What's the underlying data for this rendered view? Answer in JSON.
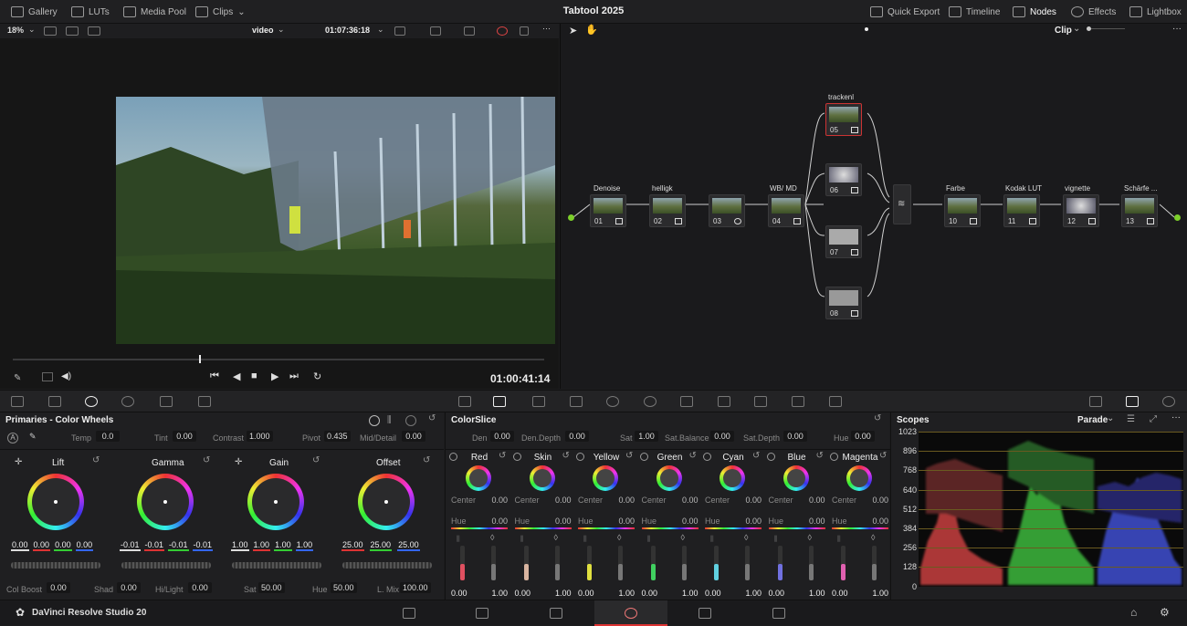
{
  "topbar": {
    "gallery": "Gallery",
    "luts": "LUTs",
    "media_pool": "Media Pool",
    "clips": "Clips",
    "title": "Tabtool 2025",
    "quick_export": "Quick Export",
    "timeline": "Timeline",
    "nodes": "Nodes",
    "effects": "Effects",
    "lightbox": "Lightbox"
  },
  "viewer": {
    "zoom": "18%",
    "view_mode": "video",
    "timecode": "01:07:36:18",
    "playhead_timecode": "01:00:41:14",
    "scrub_position": 0.35
  },
  "nodes": {
    "mode": "Clip",
    "list": [
      {
        "label": "Denoise",
        "num": "01"
      },
      {
        "label": "helligk",
        "num": "02"
      },
      {
        "label": "",
        "num": "03"
      },
      {
        "label": "WB/ MD",
        "num": "04"
      },
      {
        "label": "trackenl",
        "num": "05"
      },
      {
        "label": "",
        "num": "06"
      },
      {
        "label": "",
        "num": "07"
      },
      {
        "label": "",
        "num": "08"
      },
      {
        "label": "Farbe",
        "num": "10"
      },
      {
        "label": "Kodak LUT",
        "num": "11"
      },
      {
        "label": "vignette",
        "num": "12"
      },
      {
        "label": "Schärfe ...",
        "num": "13"
      }
    ]
  },
  "primaries": {
    "title": "Primaries - Color Wheels",
    "temp_label": "Temp",
    "temp": "0.0",
    "tint_label": "Tint",
    "tint": "0.00",
    "contrast_label": "Contrast",
    "contrast": "1.000",
    "pivot_label": "Pivot",
    "pivot": "0.435",
    "middetail_label": "Mid/Detail",
    "middetail": "0.00",
    "wheels": [
      {
        "name": "Lift",
        "values": [
          "0.00",
          "0.00",
          "0.00",
          "0.00"
        ]
      },
      {
        "name": "Gamma",
        "values": [
          "-0.01",
          "-0.01",
          "-0.01",
          "-0.01"
        ]
      },
      {
        "name": "Gain",
        "values": [
          "1.00",
          "1.00",
          "1.00",
          "1.00"
        ]
      },
      {
        "name": "Offset",
        "values": [
          "25.00",
          "25.00",
          "25.00"
        ]
      }
    ],
    "colboost_label": "Col Boost",
    "colboost": "0.00",
    "shad_label": "Shad",
    "shad": "0.00",
    "hilight_label": "Hi/Light",
    "hilight": "0.00",
    "sat_label": "Sat",
    "sat": "50.00",
    "hue_label": "Hue",
    "hue": "50.00",
    "lmix_label": "L. Mix",
    "lmix": "100.00"
  },
  "colorslice": {
    "title": "ColorSlice",
    "den_label": "Den",
    "den": "0.00",
    "dendepth_label": "Den.Depth",
    "dendepth": "0.00",
    "sat_label": "Sat",
    "sat": "1.00",
    "satbal_label": "Sat.Balance",
    "satbal": "0.00",
    "satdepth_label": "Sat.Depth",
    "satdepth": "0.00",
    "hue_label": "Hue",
    "hue": "0.00",
    "center_label": "Center",
    "hue_row_label": "Hue",
    "slices": [
      {
        "name": "Red",
        "center": "0.00",
        "hue": "0.00",
        "v1": "0.00",
        "v2": "1.00",
        "color": "#e05060"
      },
      {
        "name": "Skin",
        "center": "0.00",
        "hue": "0.00",
        "v1": "0.00",
        "v2": "1.00",
        "color": "#d8b4a0"
      },
      {
        "name": "Yellow",
        "center": "0.00",
        "hue": "0.00",
        "v1": "0.00",
        "v2": "1.00",
        "color": "#e0e040"
      },
      {
        "name": "Green",
        "center": "0.00",
        "hue": "0.00",
        "v1": "0.00",
        "v2": "1.00",
        "color": "#40d060"
      },
      {
        "name": "Cyan",
        "center": "0.00",
        "hue": "0.00",
        "v1": "0.00",
        "v2": "1.00",
        "color": "#60d0e0"
      },
      {
        "name": "Blue",
        "center": "0.00",
        "hue": "0.00",
        "v1": "0.00",
        "v2": "1.00",
        "color": "#7070e0"
      },
      {
        "name": "Magenta",
        "center": "0.00",
        "hue": "0.00",
        "v1": "0.00",
        "v2": "1.00",
        "color": "#e060b0"
      }
    ]
  },
  "scopes": {
    "title": "Scopes",
    "mode": "Parade",
    "axis": [
      "1023",
      "896",
      "768",
      "640",
      "512",
      "384",
      "256",
      "128",
      "0"
    ]
  },
  "bottombar": {
    "app": "DaVinci Resolve Studio 20"
  }
}
